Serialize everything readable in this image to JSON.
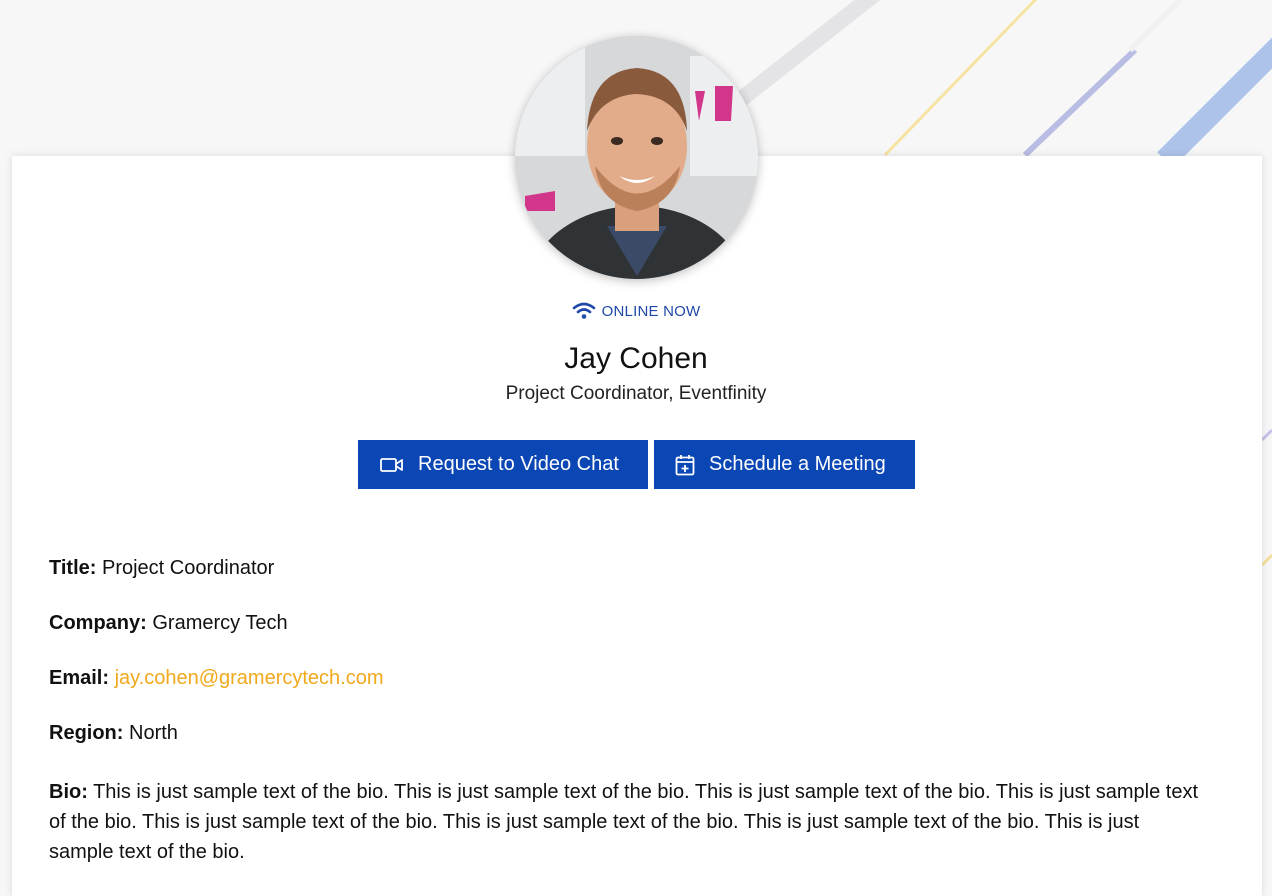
{
  "status": {
    "label": "ONLINE NOW",
    "color": "#1f48a8"
  },
  "profile": {
    "name": "Jay Cohen",
    "subtitle": "Project Coordinator, Eventfinity"
  },
  "actions": {
    "video_chat_label": "Request to Video Chat",
    "schedule_label": "Schedule a Meeting",
    "button_color": "#0a46b4"
  },
  "details": {
    "title_label": "Title:",
    "title_value": "Project Coordinator",
    "company_label": "Company:",
    "company_value": "Gramercy Tech",
    "email_label": "Email:",
    "email_value": "jay.cohen@gramercytech.com",
    "region_label": "Region:",
    "region_value": "North",
    "bio_label": "Bio:",
    "bio_value": "This is just sample text of the bio. This is just sample text of the bio. This is just sample text of the bio. This is just sample text of the bio. This is just sample text of the bio. This is just sample text of the bio. This is just sample text of the bio. This is just sample text of the bio."
  },
  "colors": {
    "accent": "#0a46b4",
    "link": "#f0a81c"
  },
  "icons": {
    "status": "wifi-icon",
    "video": "video-camera-icon",
    "calendar": "calendar-add-icon"
  }
}
